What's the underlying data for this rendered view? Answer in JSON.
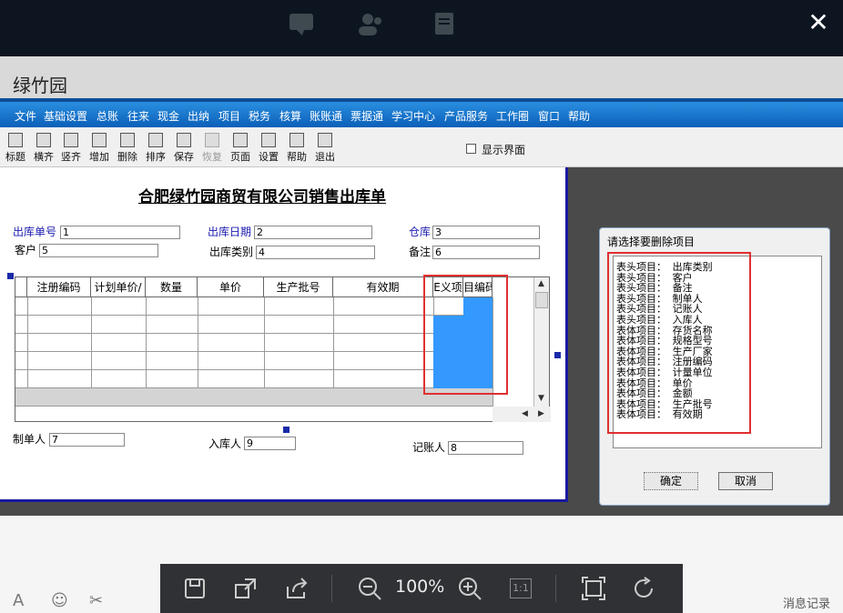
{
  "app": {
    "title": "绿竹园"
  },
  "menu": [
    "文件",
    "基础设置",
    "总账",
    "往来",
    "现金",
    "出纳",
    "项目",
    "税务",
    "核算",
    "账账通",
    "票据通",
    "学习中心",
    "产品服务",
    "工作圈",
    "窗口",
    "帮助"
  ],
  "toolbar": {
    "buttons": [
      "标题",
      "横齐",
      "竖齐",
      "增加",
      "删除",
      "排序",
      "保存",
      "恢复",
      "页面",
      "设置",
      "帮助",
      "退出"
    ],
    "show_ui_label": "显示界面"
  },
  "doc": {
    "title": "合肥绿竹园商贸有限公司销售出库单",
    "fields": {
      "order_no_label": "出库单号",
      "order_no": "1",
      "date_label": "出库日期",
      "date": "2",
      "warehouse_label": "仓库",
      "warehouse": "3",
      "customer_label": "客户",
      "customer": "5",
      "type_label": "出库类别",
      "type": "4",
      "note_label": "备注",
      "note": "6",
      "maker_label": "制单人",
      "maker": "7",
      "receiver_label": "入库人",
      "receiver": "9",
      "accountant_label": "记账人",
      "accountant": "8"
    },
    "columns": [
      "注册编码",
      "计划单价/",
      "数量",
      "单价",
      "生产批号",
      "有效期",
      "E义项",
      "目编码"
    ]
  },
  "dialog": {
    "title": "请选择要删除项目",
    "items": [
      "表头项目： 出库类别",
      "表头项目： 客户",
      "表头项目： 备注",
      "表头项目： 制单人",
      "表头项目： 记账人",
      "表头项目： 入库人",
      "表体项目： 存货名称",
      "表体项目： 规格型号",
      "表体项目： 生产厂家",
      "表体项目： 注册编码",
      "表体项目： 计量单位",
      "表体项目： 单价",
      "表体项目： 金额",
      "表体项目： 生产批号",
      "表体项目： 有效期"
    ],
    "ok": "确定",
    "cancel": "取消"
  },
  "viewer": {
    "zoom": "100%",
    "one_to_one": "1:1",
    "messages": "消息记录"
  }
}
